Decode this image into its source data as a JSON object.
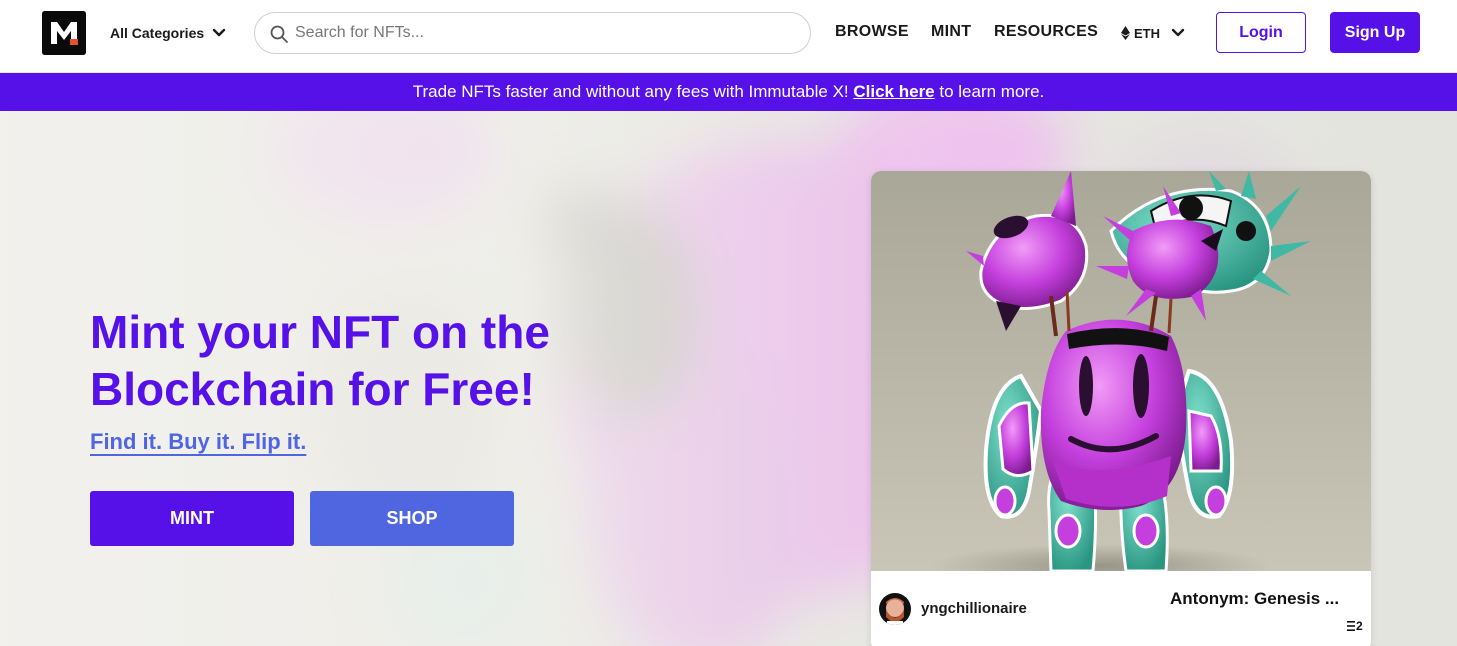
{
  "header": {
    "logo_alt": "M",
    "category_select": {
      "value": "All Categories"
    },
    "search": {
      "placeholder": "Search for NFTs..."
    },
    "nav": {
      "browse": "BROWSE",
      "mint": "MINT",
      "resources": "RESOURCES"
    },
    "currency_select": {
      "value": "ETH"
    },
    "login_label": "Login",
    "signup_label": "Sign Up"
  },
  "banner": {
    "text_before": "Trade NFTs faster and without any fees with Immutable X! ",
    "link_text": "Click here",
    "text_after": " to learn more."
  },
  "hero": {
    "title": "Mint your NFT on the Blockchain for Free!",
    "subtitle": "Find it. Buy it. Flip it.",
    "mint_button": "MINT",
    "shop_button": "SHOP"
  },
  "featured_card": {
    "creator": "yngchillionaire",
    "title": "Antonym: Genesis ...",
    "price": "2",
    "price_icon": "eth-icon"
  },
  "colors": {
    "brand_purple": "#5611e8",
    "secondary_blue": "#5066e0",
    "nft_pink": "#c43fdd",
    "nft_teal": "#3fb9a3"
  }
}
